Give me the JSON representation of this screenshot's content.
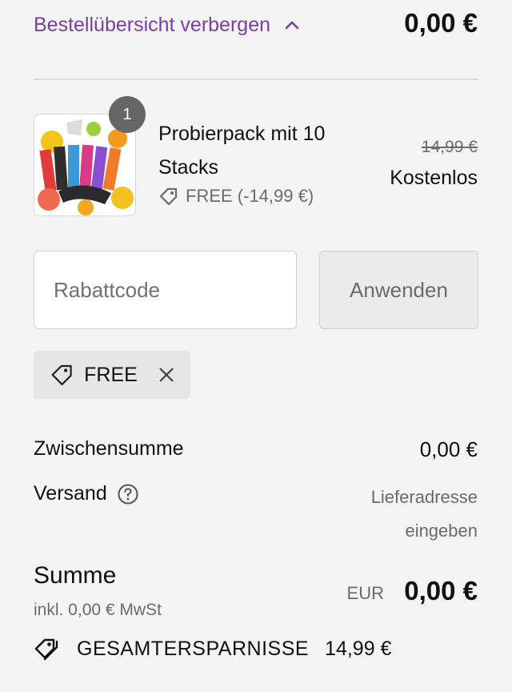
{
  "header": {
    "toggle_label": "Bestellübersicht verbergen",
    "total": "0,00 €"
  },
  "product": {
    "quantity": "1",
    "title": "Probierpack mit 10 Stacks",
    "discount": "FREE (-14,99 €)",
    "original_price": "14,99 €",
    "price": "Kostenlos"
  },
  "discount_code": {
    "placeholder": "Rabattcode",
    "value": "",
    "apply_label": "Anwenden",
    "applied_code": "FREE"
  },
  "totals": {
    "subtotal_label": "Zwischensumme",
    "subtotal_value": "0,00 €",
    "shipping_label": "Versand",
    "shipping_note": "Lieferadresse eingeben",
    "sum_label": "Summe",
    "tax_note": "inkl. 0,00 € MwSt",
    "currency": "EUR",
    "sum_value": "0,00 €",
    "savings_label": "GESAMTERSPARNISSE",
    "savings_value": "14,99 €"
  },
  "colors": {
    "accent": "#7b3fa0",
    "background": "#f4f4f4"
  },
  "icons": {
    "toggle": "chevron-up-icon",
    "discount_tag": "tag-icon",
    "remove": "close-icon",
    "help": "help-circle-icon",
    "savings": "double-tag-icon"
  }
}
